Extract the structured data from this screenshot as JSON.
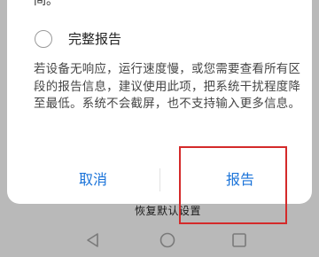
{
  "dialog": {
    "previous_line_tail": "间。",
    "option": {
      "label": "完整报告"
    },
    "description": "若设备无响应，运行速度慢，或您需要查看所有区段的报告信息，建议使用此项，把系统干扰程度降至最低。系统不会截屏，也不支持输入更多信息。",
    "buttons": {
      "cancel": "取消",
      "report": "报告"
    },
    "accent_color": "#1a73d9"
  },
  "background": {
    "partial_text": "恢复默认设置"
  },
  "annotation": {
    "highlight_color": "#d42a2a"
  },
  "navbar": {
    "icons": [
      "back-triangle-icon",
      "home-circle-icon",
      "recent-square-icon"
    ]
  }
}
